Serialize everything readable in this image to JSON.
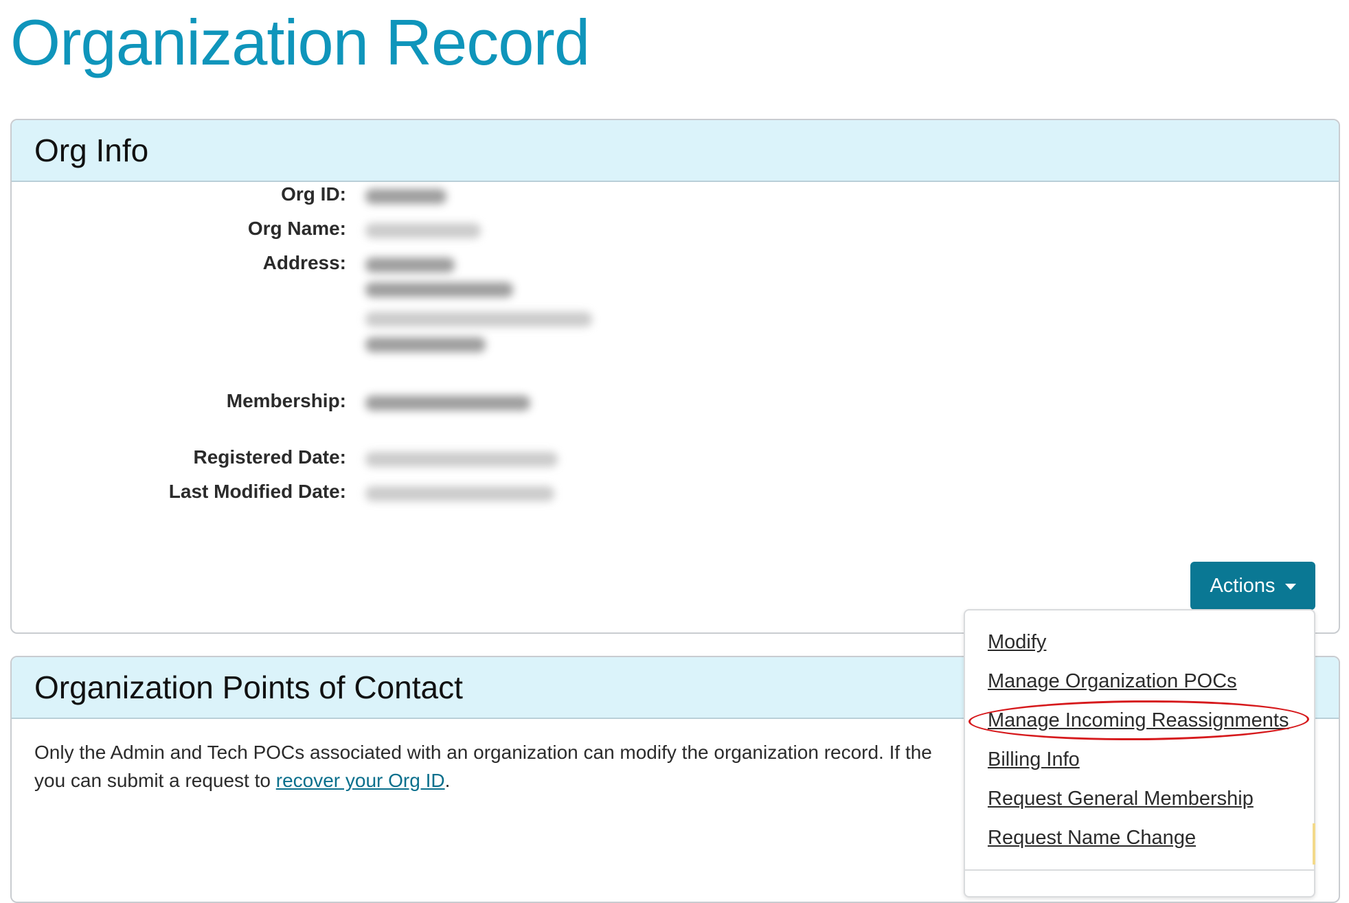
{
  "page": {
    "title": "Organization Record",
    "title_color": "#0f95bb"
  },
  "org_info": {
    "header": "Org Info",
    "fields": {
      "org_id_label": "Org ID:",
      "org_name_label": "Org Name:",
      "address_label": "Address:",
      "membership_label": "Membership:",
      "registered_date_label": "Registered Date:",
      "last_modified_label": "Last Modified Date:"
    },
    "actions_label": "Actions",
    "actions_color": "#0a7894"
  },
  "actions_menu": {
    "items": [
      "Modify",
      "Manage Organization POCs",
      "Manage Incoming Reassignments",
      "Billing Info",
      "Request General Membership",
      "Request Name Change"
    ],
    "highlighted_item": "Manage Incoming Reassignments",
    "highlight_color": "#d6191c"
  },
  "poc": {
    "header": "Organization Points of Contact",
    "text_before": "Only the Admin and Tech POCs associated with an organization can modify the organization record. If the",
    "text_line2_before": "you can submit a request to ",
    "link_text": "recover your Org ID",
    "text_after": ".",
    "link_color": "#0a6f8c"
  }
}
